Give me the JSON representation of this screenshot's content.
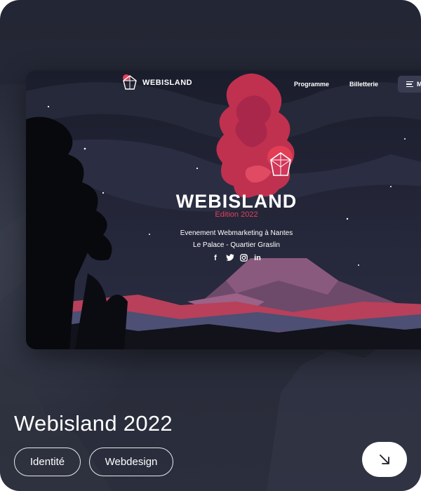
{
  "mockup": {
    "nav": {
      "logo_text": "WEBISLAND",
      "links": [
        "Programme",
        "Billetterie"
      ],
      "menu_label": "M"
    },
    "hero": {
      "title": "WEBISLAND",
      "edition": "Edition 2022",
      "subtitle_line1": "Evenement Webmarketing à Nantes",
      "subtitle_line2": "Le Palace - Quartier Graslin",
      "socials": [
        {
          "icon": "facebook-icon",
          "glyph": "f"
        },
        {
          "icon": "twitter-icon",
          "glyph": "t"
        },
        {
          "icon": "instagram-icon",
          "glyph": "o"
        },
        {
          "icon": "linkedin-icon",
          "glyph": "in"
        }
      ]
    }
  },
  "project": {
    "title": "Webisland 2022",
    "tags": [
      "Identité",
      "Webdesign"
    ],
    "open_icon": "arrow-down-right-icon"
  },
  "colors": {
    "accent": "#e0415c",
    "background": "#272a38",
    "mockup_sky": "#1a1d2b"
  }
}
